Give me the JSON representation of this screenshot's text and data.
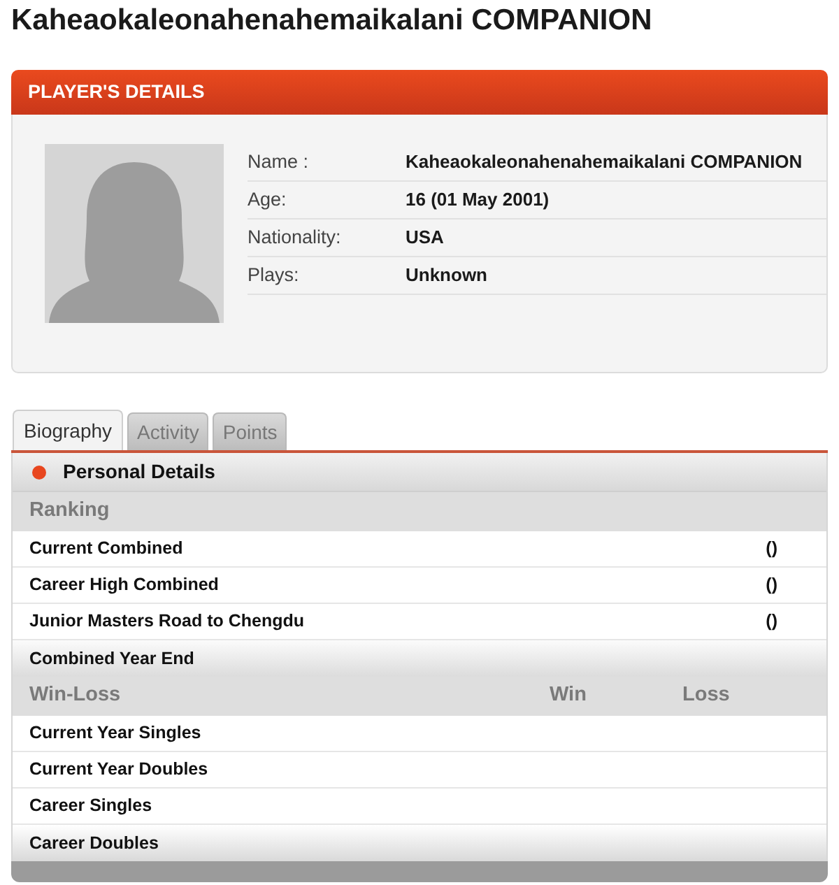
{
  "title": "Kaheaokaleonahenahemaikalani COMPANION",
  "details": {
    "header": "PLAYER'S DETAILS",
    "fields": [
      {
        "label": "Name :",
        "value": "Kaheaokaleonahenahemaikalani COMPANION"
      },
      {
        "label": "Age:",
        "value": "16 (01 May 2001)"
      },
      {
        "label": "Nationality:",
        "value": "USA"
      },
      {
        "label": "Plays:",
        "value": "Unknown"
      }
    ]
  },
  "tabs": [
    {
      "label": "Biography",
      "selected": true
    },
    {
      "label": "Activity",
      "selected": false
    },
    {
      "label": "Points",
      "selected": false
    }
  ],
  "biography": {
    "section_title": "Personal Details",
    "ranking": {
      "heading": "Ranking",
      "rows": [
        {
          "label": "Current Combined",
          "value": "()"
        },
        {
          "label": "Career High Combined",
          "value": "()"
        },
        {
          "label": "Junior Masters Road to Chengdu",
          "value": "()"
        }
      ]
    },
    "combined_year_end": {
      "heading": "Combined Year End"
    },
    "win_loss": {
      "heading": "Win-Loss",
      "columns": [
        "Win",
        "Loss"
      ],
      "rows": [
        {
          "label": "Current Year Singles"
        },
        {
          "label": "Current Year Doubles"
        },
        {
          "label": "Career Singles"
        },
        {
          "label": "Career Doubles"
        }
      ]
    }
  }
}
